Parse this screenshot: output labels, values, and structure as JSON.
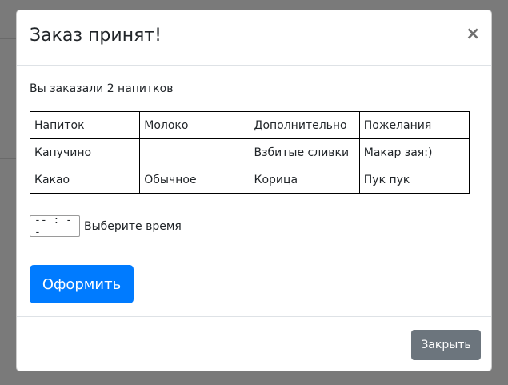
{
  "modal": {
    "title": "Заказ принят!",
    "close_icon": "×",
    "summary": "Вы заказали 2 напитков",
    "table": {
      "rows": [
        [
          "Напиток",
          "Молоко",
          "Дополнительно",
          "Пожелания"
        ],
        [
          "Капучино",
          "",
          "Взбитые сливки",
          "Макар зая:)"
        ],
        [
          "Какао",
          "Обычное",
          "Корица",
          "Пук пук"
        ]
      ]
    },
    "time_input": {
      "value": "-- : --",
      "label": "Выберите время"
    },
    "submit_label": "Оформить",
    "close_label": "Закрыть"
  },
  "colors": {
    "primary": "#007bff",
    "secondary": "#6c757d",
    "overlay": "#7a7a7a"
  }
}
